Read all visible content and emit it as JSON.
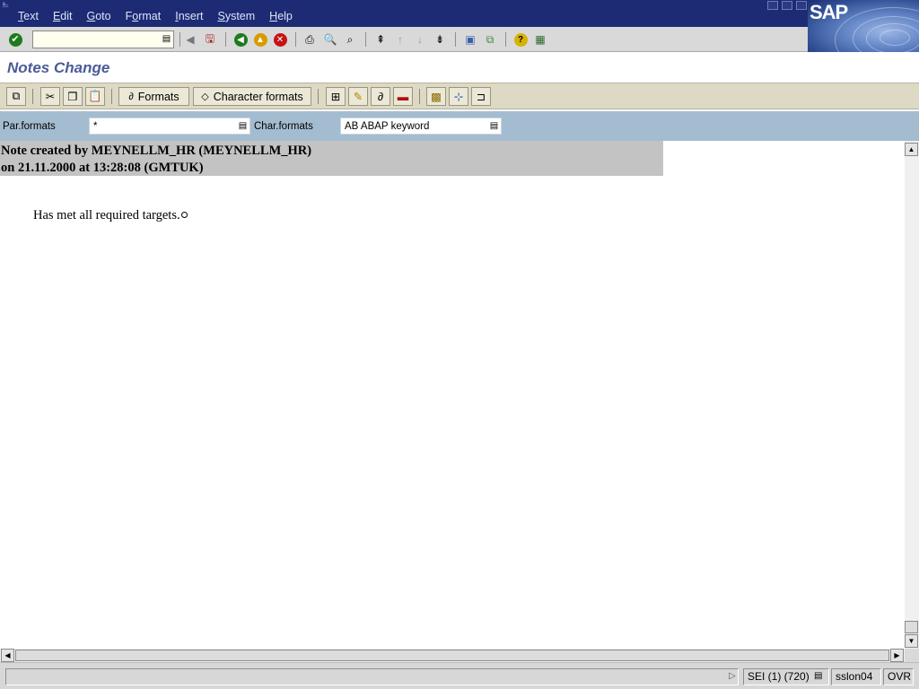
{
  "menubar": {
    "items": [
      {
        "pre": "",
        "u": "T",
        "post": "ext"
      },
      {
        "pre": "",
        "u": "E",
        "post": "dit"
      },
      {
        "pre": "",
        "u": "G",
        "post": "oto"
      },
      {
        "pre": "F",
        "u": "o",
        "post": "rmat"
      },
      {
        "pre": "",
        "u": "I",
        "post": "nsert"
      },
      {
        "pre": "",
        "u": "S",
        "post": "ystem"
      },
      {
        "pre": "",
        "u": "H",
        "post": "elp"
      }
    ]
  },
  "brand": {
    "logo": "SAP"
  },
  "command_field": {
    "value": ""
  },
  "page": {
    "title": "Notes Change"
  },
  "app_toolbar": {
    "formats_label": "Formats",
    "char_formats_label": "Character formats"
  },
  "format_row": {
    "par_label": "Par.formats",
    "par_value": "*",
    "char_label": "Char.formats",
    "char_value": "AB ABAP keyword"
  },
  "note": {
    "header_line1": "Note created by MEYNELLM_HR (MEYNELLM_HR)",
    "header_line2": "on 21.11.2000 at 13:28:08 (GMTUK)",
    "body": "Has met all required targets."
  },
  "status": {
    "session": "SEI (1) (720)",
    "server": "sslon04",
    "mode": "OVR"
  },
  "colors": {
    "title_bar": "#1c2b74",
    "app_toolbar": "#ded9c5",
    "format_row": "#a4bcd0",
    "title_text": "#4a5c97"
  }
}
